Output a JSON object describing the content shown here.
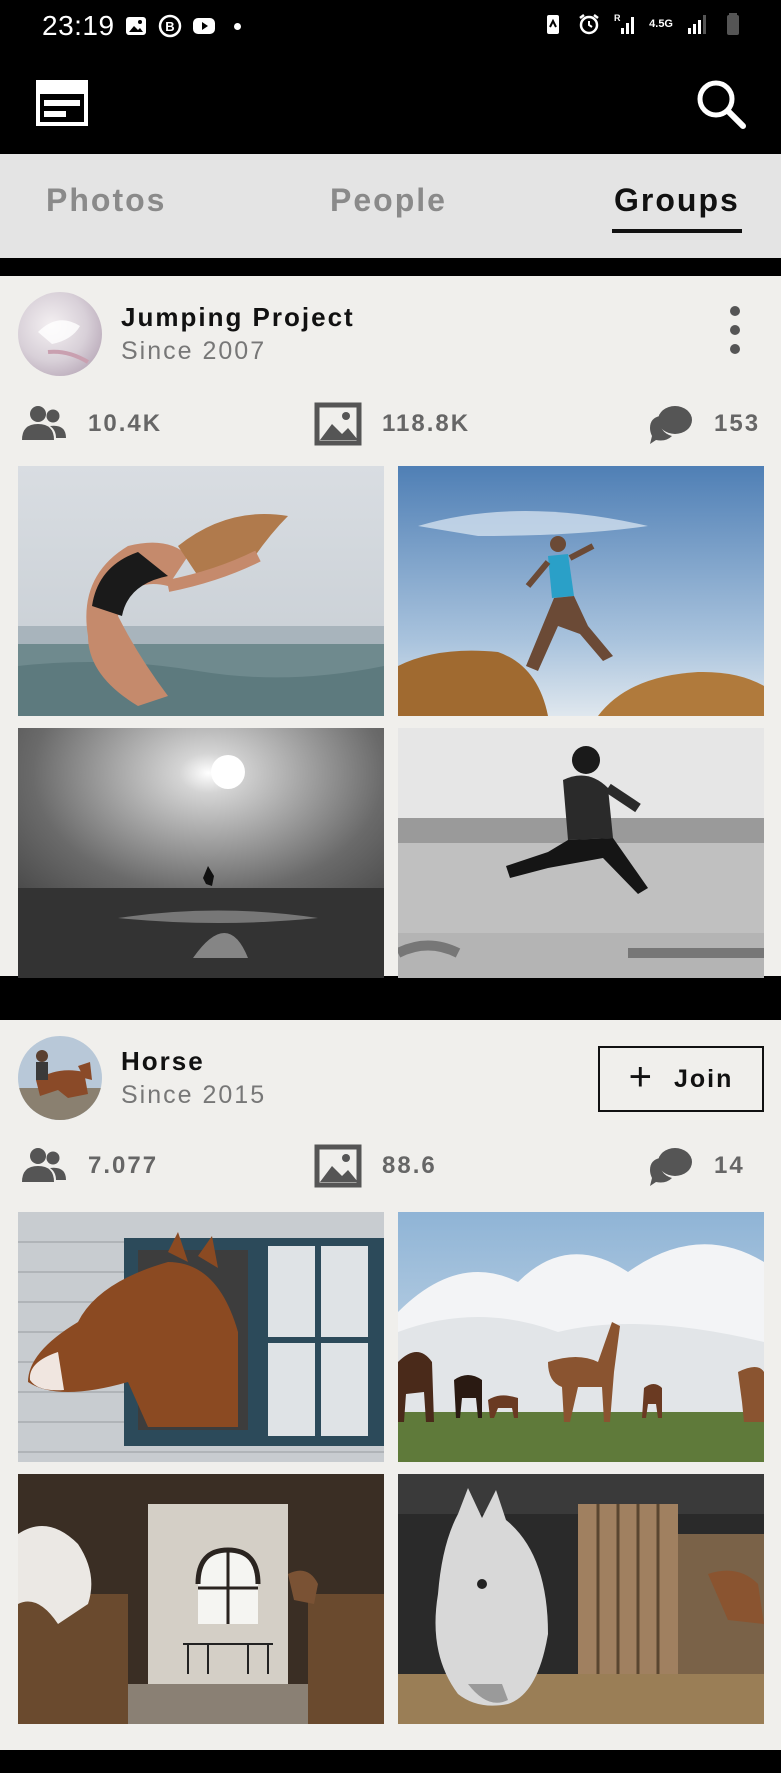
{
  "status_bar": {
    "time": "23:19",
    "network_label": "4.5G",
    "roaming_label": "R"
  },
  "app_bar": {
    "menu_icon": "menu-panel-icon",
    "search_icon": "search-icon"
  },
  "tabs": [
    {
      "label": "Photos",
      "active": false
    },
    {
      "label": "People",
      "active": false
    },
    {
      "label": "Groups",
      "active": true
    }
  ],
  "groups": [
    {
      "name": "Jumping Project",
      "since": "Since 2007",
      "members": "10.4K",
      "photos": "118.8K",
      "comments": "153",
      "action": "more-options",
      "thumbnails": [
        "Dancer leaping in black swimsuit by the sea",
        "Runner leaping between rocks under blue sky",
        "Silhouette jumping on beach under sun",
        "Man jumping by harbour in black and white"
      ]
    },
    {
      "name": "Horse",
      "since": "Since 2015",
      "members": "7.077",
      "photos": "88.6",
      "comments": "14",
      "action": "join",
      "join_label": "Join",
      "thumbnails": [
        "Chestnut horse looking out of stable window",
        "Horses grazing on field under cloudy sky",
        "Inside stable with arched window",
        "White horse in wooden stable"
      ]
    }
  ],
  "colors": {
    "background": "#000000",
    "card": "#f0efec",
    "tab_bar": "#e4e4e4",
    "active_text": "#111111",
    "muted_text": "#8a8a8a",
    "stat_text": "#666666"
  }
}
